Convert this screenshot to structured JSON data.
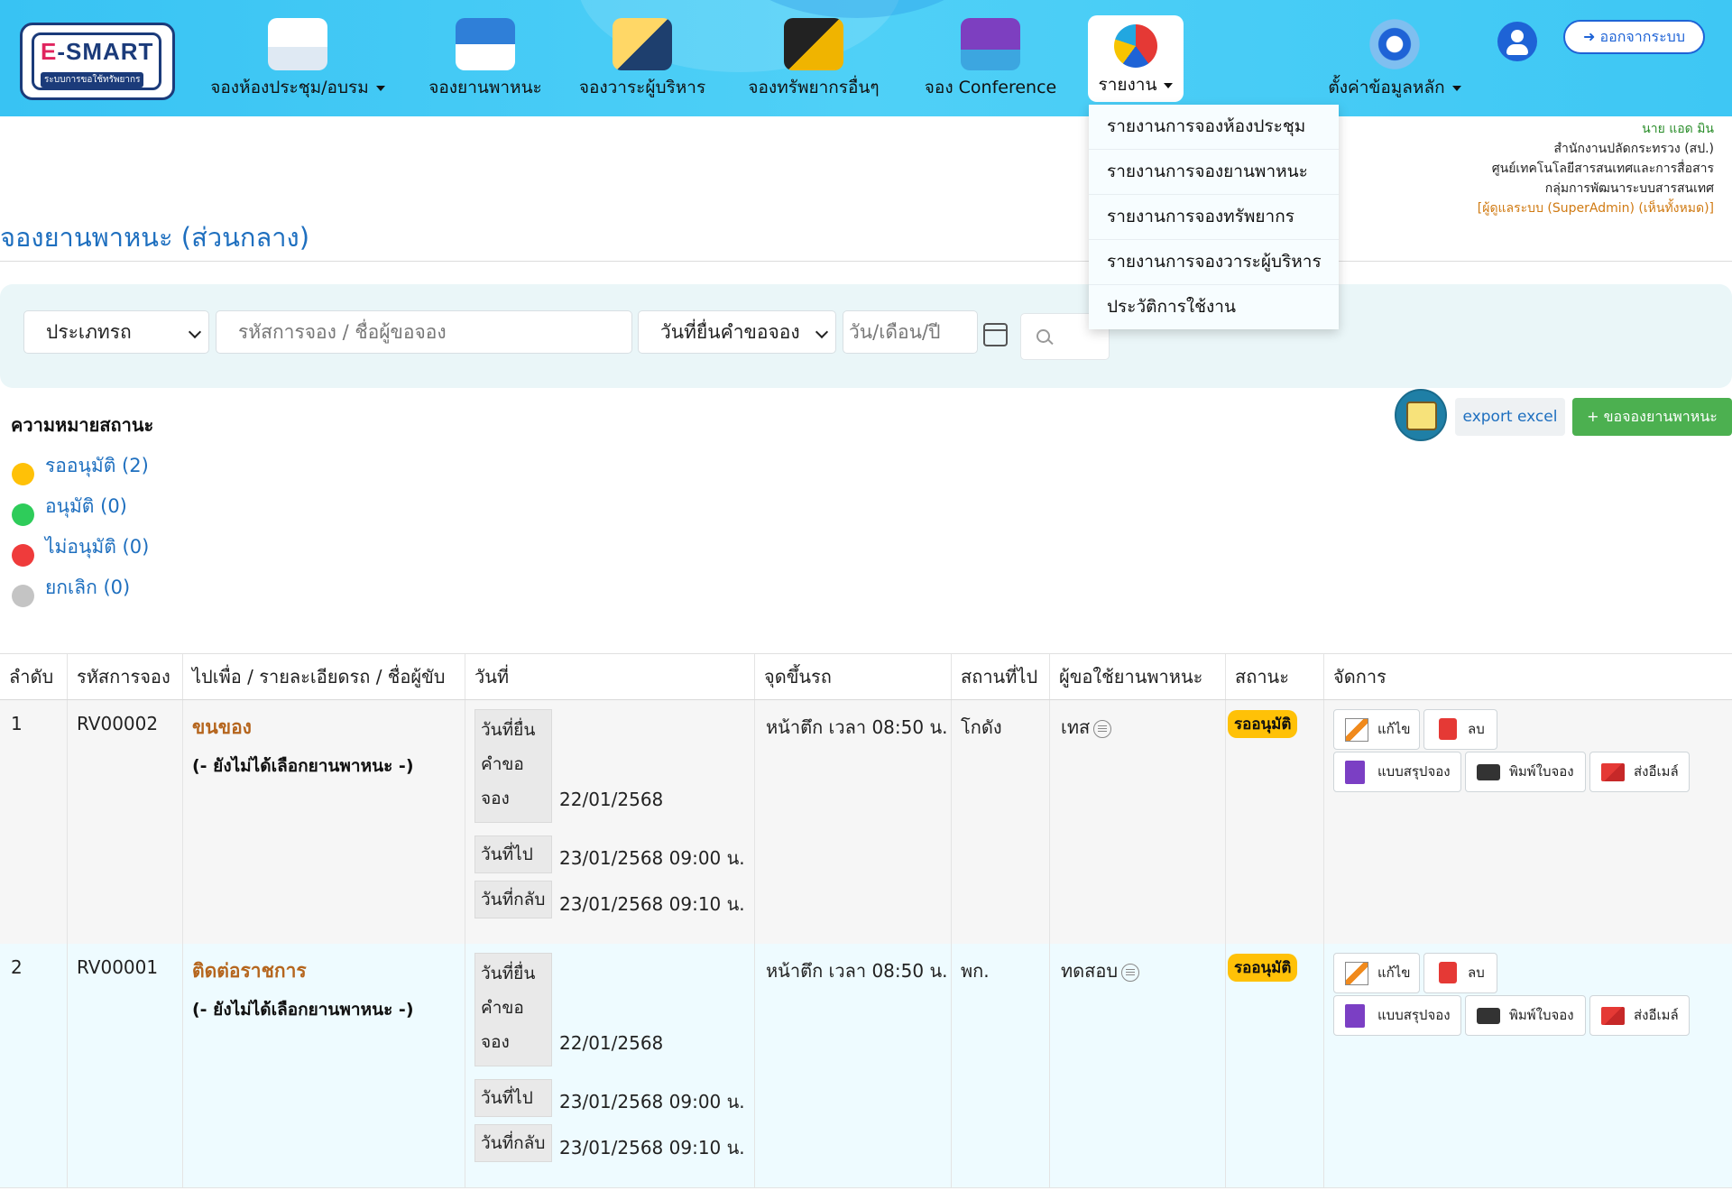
{
  "header": {
    "logo_title": "E-SMART",
    "logo_subtitle": "ระบบการขอใช้ทรัพยากร",
    "nav": [
      {
        "label": "จองห้องประชุม/อบรม",
        "icon": "meeting-room-icon"
      },
      {
        "label": "จองยานพาหนะ",
        "icon": "vehicle-icon"
      },
      {
        "label": "จองวาระผู้บริหาร",
        "icon": "executive-icon"
      },
      {
        "label": "จองทรัพยากรอื่นๆ",
        "icon": "resources-icon"
      },
      {
        "label": "จอง Conference",
        "icon": "conference-icon"
      },
      {
        "label": "รายงาน",
        "icon": "pie-chart-icon"
      },
      {
        "label": "ตั้งค่าข้อมูลหลัก",
        "icon": "gear-icon"
      }
    ],
    "logout_label": "ออกจากระบบ"
  },
  "report_menu": [
    "รายงานการจองห้องประชุม",
    "รายงานการจองยานพาหนะ",
    "รายงานการจองทรัพยากร",
    "รายงานการจองวาระผู้บริหาร",
    "ประวัติการใช้งาน"
  ],
  "user": {
    "name": "นาย แอด มิน",
    "org1": "สำนักงานปลัดกระทรวง (สป.)",
    "org2": "ศูนย์เทคโนโลยีสารสนเทศและการสื่อสาร",
    "org3": "กลุ่มการพัฒนาระบบสารสนเทศ",
    "role": "[ผู้ดูแลระบบ (SuperAdmin) (เห็นทั้งหมด)]"
  },
  "page_title": "จองยานพาหนะ (ส่วนกลาง)",
  "filters": {
    "vehicle_type": "ประเภทรถ",
    "search_placeholder": "รหัสการจอง / ชื่อผู้ขอจอง",
    "date_type": "วันที่ยื่นคำขอจอง",
    "date_placeholder": "วัน/เดือน/ปี"
  },
  "actions": {
    "export_label": "export excel",
    "add_label": "+ ขอจองยานพาหนะ"
  },
  "legend": {
    "title": "ความหมายสถานะ",
    "items": [
      {
        "label": "รออนุมัติ (2)",
        "color": "#ffc107"
      },
      {
        "label": "อนุมัติ (0)",
        "color": "#2ecc5a"
      },
      {
        "label": "ไม่อนุมัติ (0)",
        "color": "#ef3b3b"
      },
      {
        "label": "ยกเลิก (0)",
        "color": "#c4c4c4"
      }
    ]
  },
  "table": {
    "headers": [
      "ลำดับ",
      "รหัสการจอง",
      "ไปเพื่อ / รายละเอียดรถ / ชื่อผู้ขับ",
      "วันที่",
      "จุดขึ้นรถ",
      "สถานที่ไป",
      "ผู้ขอใช้ยานพาหนะ",
      "สถานะ",
      "จัดการ"
    ],
    "date_labels": {
      "submit": "วันที่ยื่นคำขอจอง",
      "submit_l1": "วันที่ยื่น",
      "submit_l2": "คำขอ",
      "submit_l3": "จอง",
      "depart": "วันที่ไป",
      "return": "วันที่กลับ"
    },
    "buttons": {
      "edit": "แก้ไข",
      "delete": "ลบ",
      "summary": "แบบสรุปจอง",
      "print": "พิมพ์ใบจอง",
      "email": "ส่งอีเมล์"
    },
    "rows": [
      {
        "no": "1",
        "code": "RV00002",
        "purpose": "ขนของ",
        "vehicle": "(- ยังไม่ได้เลือกยานพาหนะ -)",
        "submit_date": "22/01/2568",
        "depart": "23/01/2568 09:00 น.",
        "return": "23/01/2568 09:10 น.",
        "pickup": "หน้าตึก เวลา 08:50 น.",
        "destination": "โกดัง",
        "requester": "เทส",
        "status": "รออนุมัติ"
      },
      {
        "no": "2",
        "code": "RV00001",
        "purpose": "ติดต่อราชการ",
        "vehicle": "(- ยังไม่ได้เลือกยานพาหนะ -)",
        "submit_date": "22/01/2568",
        "depart": "23/01/2568 09:00 น.",
        "return": "23/01/2568 09:10 น.",
        "pickup": "หน้าตึก เวลา 08:50 น.",
        "destination": "พก.",
        "requester": "ทดสอบ",
        "status": "รออนุมัติ"
      }
    ]
  }
}
